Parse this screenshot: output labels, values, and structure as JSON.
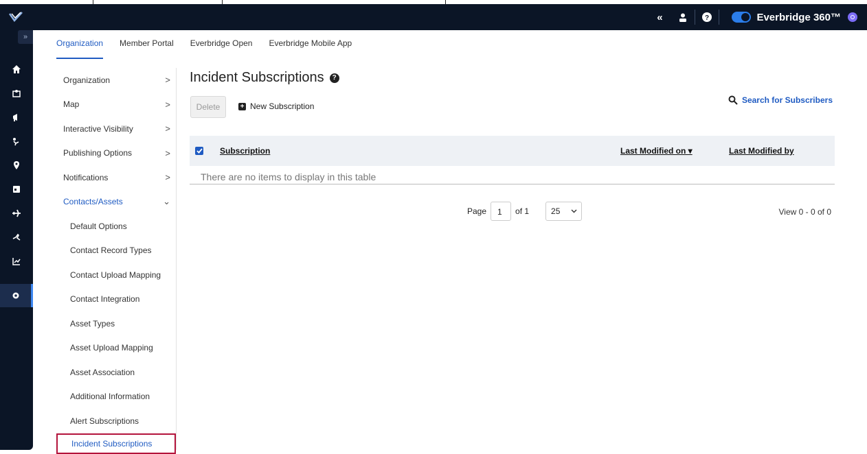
{
  "topbar": {
    "brand": "Everbridge 360™",
    "icons": [
      "collapse-icon",
      "user-icon",
      "help-icon"
    ]
  },
  "rail": {
    "expand_glyph": "»",
    "items": [
      "home-icon",
      "map-icon",
      "megaphone-icon",
      "incident-icon",
      "location-icon",
      "calendar-icon",
      "travel-icon",
      "flight-icon",
      "analytics-icon",
      "settings-icon"
    ]
  },
  "tabs": [
    "Organization",
    "Member Portal",
    "Everbridge Open",
    "Everbridge Mobile App"
  ],
  "sidenav": {
    "items": [
      {
        "label": "Organization",
        "chevron": ">"
      },
      {
        "label": "Map",
        "chevron": ">"
      },
      {
        "label": "Interactive Visibility",
        "chevron": ">"
      },
      {
        "label": "Publishing Options",
        "chevron": ">"
      },
      {
        "label": "Notifications",
        "chevron": ">"
      },
      {
        "label": "Contacts/Assets",
        "chevron": "⌄"
      }
    ],
    "subitems": [
      "Default Options",
      "Contact Record Types",
      "Contact Upload Mapping",
      "Contact Integration",
      "Asset Types",
      "Asset Upload Mapping",
      "Asset Association",
      "Additional Information",
      "Alert Subscriptions",
      "Incident Subscriptions"
    ]
  },
  "main": {
    "title": "Incident Subscriptions",
    "delete_label": "Delete",
    "new_label": "New Subscription",
    "search_label": "Search for Subscribers",
    "columns": {
      "subscription": "Subscription",
      "last_modified_on": "Last Modified on ▾",
      "last_modified_by": "Last Modified by"
    },
    "empty_text": "There are no items to display in this table",
    "pager": {
      "page_label": "Page",
      "page_value": "1",
      "of_label": "of 1",
      "per_page": "25",
      "view_count": "View 0 - 0 of 0"
    }
  },
  "colors": {
    "navy": "#0b1526",
    "accent": "#1f5bc2",
    "selected_border": "#b3133b"
  }
}
